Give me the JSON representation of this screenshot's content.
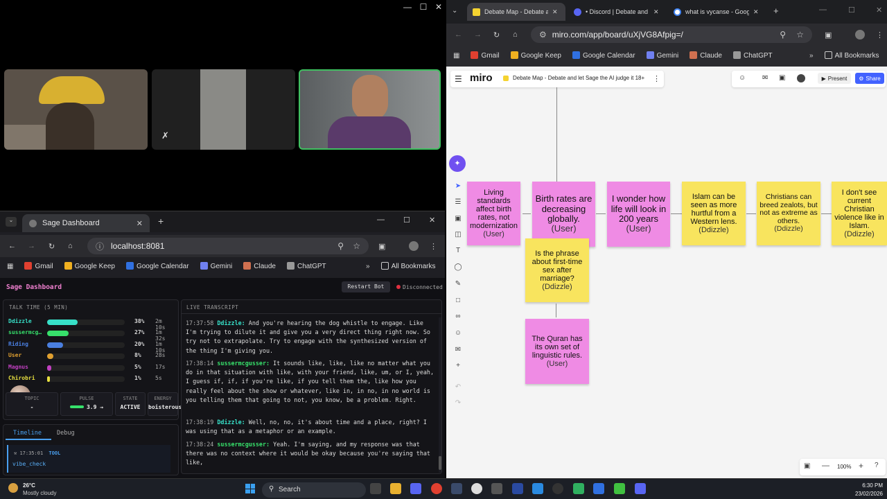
{
  "dashboard": {
    "tab_title": "Sage Dashboard",
    "url": "localhost:8081",
    "bookmarks": [
      "Gmail",
      "Google Keep",
      "Google Calendar",
      "Gemini",
      "Claude",
      "ChatGPT"
    ],
    "all_bookmarks": "All Bookmarks",
    "app_title": "Sage Dashboard",
    "restart_label": "Restart Bot",
    "status": "Disconnected",
    "talk_time_title": "TALK TIME (5 MIN)",
    "talk_time": [
      {
        "name": "Ddizzle",
        "pct": "38%",
        "time": "2m 10s",
        "fraction": 0.38,
        "color": "#37e0c8"
      },
      {
        "name": "sussermcg…",
        "pct": "27%",
        "time": "1m 32s",
        "fraction": 0.27,
        "color": "#37e06b"
      },
      {
        "name": "Riding",
        "pct": "20%",
        "time": "1m 10s",
        "fraction": 0.2,
        "color": "#4a7fe0"
      },
      {
        "name": "User",
        "pct": "8%",
        "time": "28s",
        "fraction": 0.08,
        "color": "#e0a030"
      },
      {
        "name": "Magnus",
        "pct": "5%",
        "time": "17s",
        "fraction": 0.05,
        "color": "#c040c0"
      },
      {
        "name": "Chirobri",
        "pct": "1%",
        "time": "5s",
        "fraction": 0.01,
        "color": "#e8e040"
      }
    ],
    "stats": [
      {
        "label": "TOPIC",
        "value": "-"
      },
      {
        "label": "PULSE",
        "value": "3.9 →"
      },
      {
        "label": "STATE",
        "value": "ACTIVE"
      },
      {
        "label": "ENERGY",
        "value": "boisterous"
      }
    ],
    "tabs": [
      "Timeline",
      "Debug"
    ],
    "timeline_time": "17:35:01",
    "timeline_badge": "TOOL",
    "timeline_item": "vibe_check",
    "transcript_title": "LIVE TRANSCRIPT",
    "transcript": [
      {
        "ts": "17:37:58",
        "speaker": "Ddizzle:",
        "text": "And you're hearing the dog whistle to engage. Like I'm trying to dilute it and give you a very direct thing right now. So try not to extrapolate. Try to engage with the synthesized version of the thing I'm giving you."
      },
      {
        "ts": "17:38:14",
        "speaker": "sussermcgusser:",
        "text": "It sounds like, like, like no matter what you do in that situation with like, with your friend, like, um, or I, yeah, I guess if, if, if you're like, if you tell them the, like how you really feel about the show or whatever, like in, in no, in no world is you telling them that going to not, you know, be a problem. Right."
      },
      {
        "ts": "17:38:19",
        "speaker": "Ddizzle:",
        "text": "Well, no, no, it's about time and a place, right? I was using that as a metaphor or an example."
      },
      {
        "ts": "17:38:24",
        "speaker": "sussermcgusser:",
        "text": "Yeah. I'm saying, and my response was that there was no context where it would be okay because you're saying that like,"
      }
    ]
  },
  "miro": {
    "tabs": [
      "Debate Map - Debate an",
      "• Discord | Debate and l",
      "what is vycanse - Googl"
    ],
    "url": "miro.com/app/board/uXjVG8Afpig=/",
    "bookmarks": [
      "Gmail",
      "Google Keep",
      "Google Calendar",
      "Gemini",
      "Claude",
      "ChatGPT"
    ],
    "all_bookmarks": "All Bookmarks",
    "logo": "miro",
    "board_title": "Debate Map - Debate and let Sage the AI judge it 18+",
    "present": "Present",
    "share": "Share",
    "zoom": "100%",
    "notes": [
      {
        "text": "Living standards affect birth rates, not modernization",
        "who": "(User)"
      },
      {
        "text": "Birth rates are decreasing globally.",
        "who": "(User)"
      },
      {
        "text": "I wonder how life will look in 200 years",
        "who": "(User)"
      },
      {
        "text": "Islam can be seen as more hurtful from a Western lens.",
        "who": "(Ddizzle)"
      },
      {
        "text": "Christians can breed zealots, but not as extreme as others.",
        "who": "(Ddizzle)"
      },
      {
        "text": "I don't see current Christian violence like in Islam.",
        "who": "(Ddizzle)"
      },
      {
        "text": "Is the phrase about first-time sex after marriage?",
        "who": "(Ddizzle)"
      },
      {
        "text": "The Quran has its own set of linguistic rules.",
        "who": "(User)"
      }
    ]
  },
  "taskbar": {
    "temp": "26°C",
    "weather": "Mostly cloudy",
    "search": "Search",
    "time": "6:30 PM",
    "date": "23/02/2026"
  }
}
